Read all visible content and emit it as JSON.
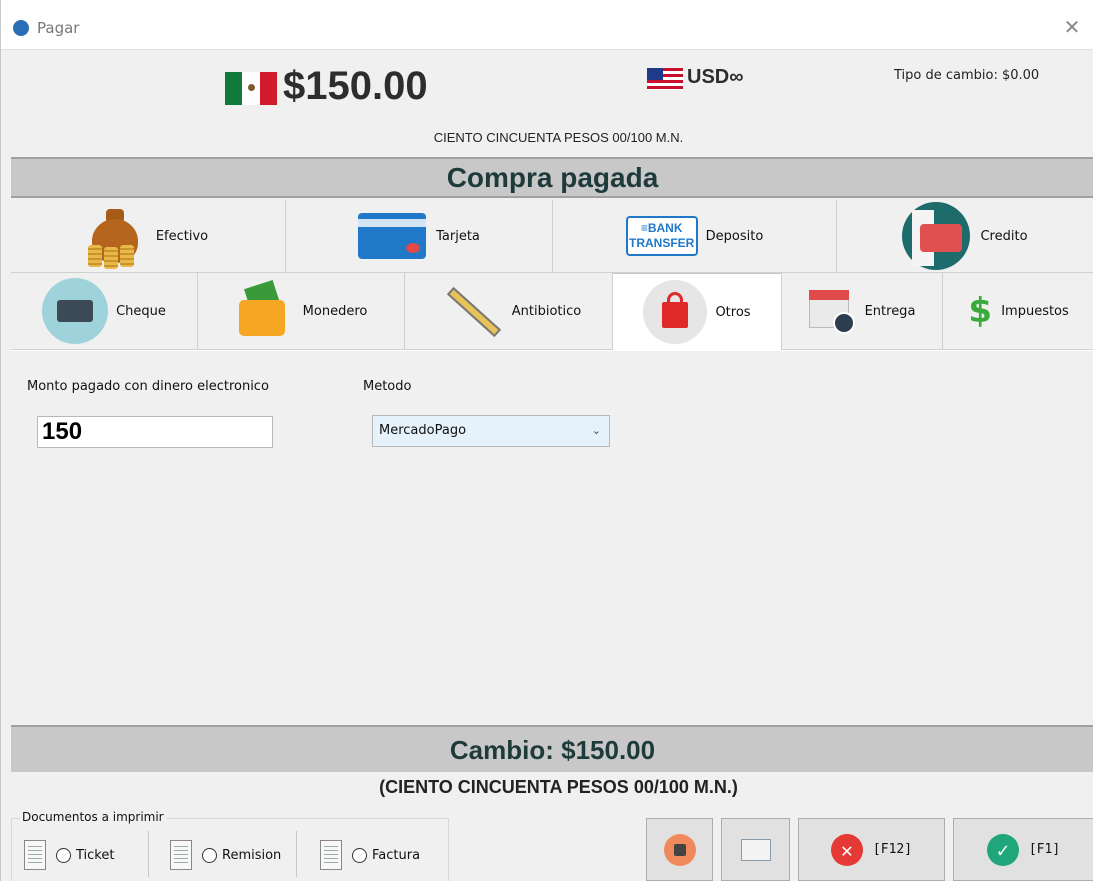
{
  "window": {
    "title": "Pagar",
    "close_glyph": "✕"
  },
  "header": {
    "amount": "$150.00",
    "currency": "USD∞",
    "exchange_rate": "Tipo de cambio: $0.00",
    "amount_words": "CIENTO CINCUENTA PESOS  00/100 M.N."
  },
  "status_banner": "Compra pagada",
  "tabs_row1": [
    {
      "label": "Efectivo",
      "icon": "money-bag-icon"
    },
    {
      "label": "Tarjeta",
      "icon": "card-icon"
    },
    {
      "label": "Deposito",
      "icon": "bank-transfer-icon",
      "icon_text": "≡BANK\nTRANSFER"
    },
    {
      "label": "Credito",
      "icon": "credit-card-receipt-icon"
    }
  ],
  "tabs_row2": [
    {
      "label": "Cheque",
      "icon": "cheque-icon"
    },
    {
      "label": "Monedero",
      "icon": "wallet-icon"
    },
    {
      "label": "Antibiotico",
      "icon": "syringe-icon"
    },
    {
      "label": "Otros",
      "icon": "shopping-bag-icon",
      "active": true
    },
    {
      "label": "Entrega",
      "icon": "calendar-clock-icon"
    },
    {
      "label": "Impuestos",
      "icon": "dollar-icon"
    }
  ],
  "form": {
    "monto_label": "Monto pagado con dinero electronico",
    "monto_value": "150",
    "metodo_label": "Metodo",
    "metodo_value": "MercadoPago"
  },
  "change": {
    "label": "Cambio: $150.00",
    "words": "(CIENTO CINCUENTA PESOS  00/100 M.N.)"
  },
  "documents": {
    "group_label": "Documentos a imprimir",
    "options": [
      "Ticket",
      "Remision",
      "Factura"
    ]
  },
  "buttons": {
    "cancel_label": "[F12]",
    "accept_label": "[F1]"
  },
  "colors": {
    "banner_bg": "#c8c8c8",
    "banner_text": "#1e3a3a",
    "cancel_icon": "#e53935",
    "accept_icon": "#1fa67a"
  }
}
